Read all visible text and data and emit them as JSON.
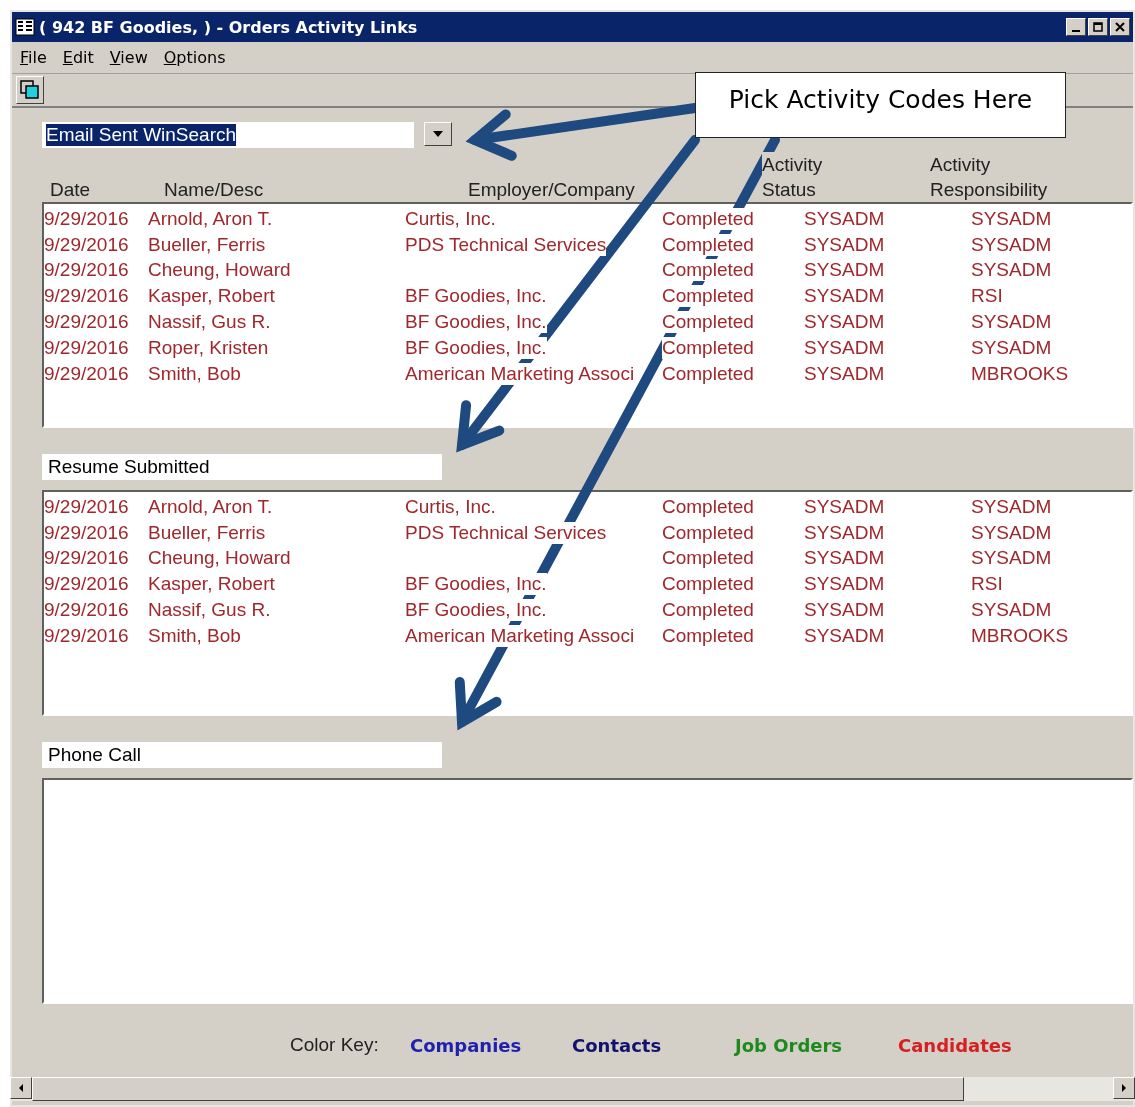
{
  "window": {
    "title": "( 942 BF Goodies,  ) - Orders Activity Links"
  },
  "menu": [
    {
      "label": "File"
    },
    {
      "label": "Edit"
    },
    {
      "label": "View"
    },
    {
      "label": "Options"
    }
  ],
  "columns": [
    "Date",
    "Name/Desc",
    "Employer/Company",
    "Activity\nStatus",
    "Activity\nResponsibility"
  ],
  "sections": [
    {
      "kind": "dropdown",
      "activity": "Email Sent WinSearch",
      "selected": true,
      "rows": [
        [
          "9/29/2016",
          "Arnold, Aron T.",
          "Curtis, Inc.",
          "Completed",
          "SYSADM",
          "SYSADM"
        ],
        [
          "9/29/2016",
          "Bueller, Ferris",
          "PDS Technical Services",
          "Completed",
          "SYSADM",
          "SYSADM"
        ],
        [
          "9/29/2016",
          "Cheung, Howard",
          "",
          "Completed",
          "SYSADM",
          "SYSADM"
        ],
        [
          "9/29/2016",
          "Kasper, Robert",
          "BF Goodies, Inc.",
          "Completed",
          "SYSADM",
          "RSI"
        ],
        [
          "9/29/2016",
          "Nassif, Gus R.",
          "BF Goodies, Inc.",
          "Completed",
          "SYSADM",
          "SYSADM"
        ],
        [
          "9/29/2016",
          "Roper, Kristen",
          "BF Goodies, Inc.",
          "Completed",
          "SYSADM",
          "SYSADM"
        ],
        [
          "9/29/2016",
          "Smith, Bob",
          "American Marketing Associ",
          "Completed",
          "SYSADM",
          "MBROOKS"
        ]
      ]
    },
    {
      "kind": "label",
      "activity": "Resume Submitted",
      "selected": false,
      "rows": [
        [
          "9/29/2016",
          "Arnold, Aron T.",
          "Curtis, Inc.",
          "Completed",
          "SYSADM",
          "SYSADM"
        ],
        [
          "9/29/2016",
          "Bueller, Ferris",
          "PDS Technical Services",
          "Completed",
          "SYSADM",
          "SYSADM"
        ],
        [
          "9/29/2016",
          "Cheung, Howard",
          "",
          "Completed",
          "SYSADM",
          "SYSADM"
        ],
        [
          "9/29/2016",
          "Kasper, Robert",
          "BF Goodies, Inc.",
          "Completed",
          "SYSADM",
          "RSI"
        ],
        [
          "9/29/2016",
          "Nassif, Gus R.",
          "BF Goodies, Inc.",
          "Completed",
          "SYSADM",
          "SYSADM"
        ],
        [
          "9/29/2016",
          "Smith, Bob",
          "American Marketing Associ",
          "Completed",
          "SYSADM",
          "MBROOKS"
        ]
      ]
    },
    {
      "kind": "label",
      "activity": "Phone Call",
      "selected": false
    }
  ],
  "color_key": {
    "label": "Color Key:",
    "items": [
      {
        "label": "Companies",
        "color": "#1f1fb0"
      },
      {
        "label": "Contacts",
        "color": "#12126e"
      },
      {
        "label": "Job Orders",
        "color": "#1e8a1e"
      },
      {
        "label": "Candidates",
        "color": "#d42020"
      }
    ]
  },
  "callout": {
    "text": "Pick Activity Codes Here"
  }
}
